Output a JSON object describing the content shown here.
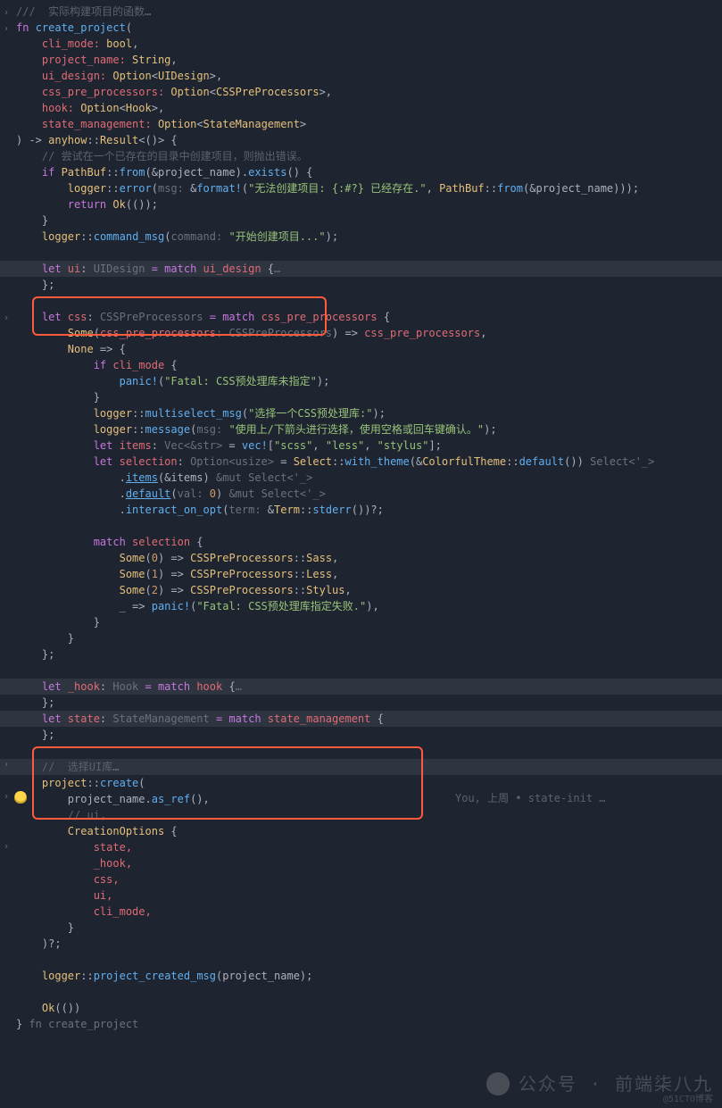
{
  "folds": [
    "›",
    "›",
    "›",
    "›",
    "›",
    "›"
  ],
  "blame": {
    "text": "You, 上周 • state-init …"
  },
  "watermark": {
    "brand": "公众号 · 前端柒八九",
    "small": "@51CTO博客"
  },
  "code": {
    "l1": {
      "a": "///  实际构建项目的函数",
      "b": "…"
    },
    "l2": {
      "a": "fn ",
      "b": "create_project",
      "c": "("
    },
    "l3": {
      "a": "    cli_mode: ",
      "b": "bool",
      "c": ","
    },
    "l4": {
      "a": "    project_name: ",
      "b": "String",
      "c": ","
    },
    "l5": {
      "a": "    ui_design: ",
      "b": "Option",
      "c": "<",
      "d": "UIDesign",
      "e": ">,"
    },
    "l6": {
      "a": "    css_pre_processors: ",
      "b": "Option",
      "c": "<",
      "d": "CSSPreProcessors",
      "e": ">,"
    },
    "l7": {
      "a": "    hook: ",
      "b": "Option",
      "c": "<",
      "d": "Hook",
      "e": ">,"
    },
    "l8": {
      "a": "    state_management: ",
      "b": "Option",
      "c": "<",
      "d": "StateManagement",
      "e": ">"
    },
    "l9": {
      "a": ") -> ",
      "b": "anyhow",
      "c": "::",
      "d": "Result",
      "e": "<()> {"
    },
    "l10": {
      "a": "    // 尝试在一个已存在的目录中创建项目，则抛出错误。"
    },
    "l11": {
      "a": "    if ",
      "b": "PathBuf",
      "c": "::",
      "d": "from",
      "e": "(&project_name).",
      "f": "exists",
      "g": "() {"
    },
    "l12": {
      "a": "        ",
      "b": "logger",
      "c": "::",
      "d": "error",
      "e": "(",
      "f": "msg: ",
      "g": "&",
      "h": "format!",
      "i": "(",
      "j": "\"无法创建项目: {:#?} 已经存在.\"",
      "k": ", ",
      "l": "PathBuf",
      "m": "::",
      "n": "from",
      "o": "(&project_name)));"
    },
    "l13": {
      "a": "        return ",
      "b": "Ok",
      "c": "(());"
    },
    "l14": {
      "a": "    }"
    },
    "l15": {
      "a": "    ",
      "b": "logger",
      "c": "::",
      "d": "command_msg",
      "e": "(",
      "f": "command: ",
      "g": "\"开始创建项目...\"",
      "h": ");"
    },
    "l16": {
      "a": ""
    },
    "l17": {
      "a": "    let ",
      "b": "ui",
      "c": ": ",
      "d": "UIDesign",
      "e": " = match ",
      "f": "ui_design",
      " g": " {",
      "h": "…"
    },
    "l18": {
      "a": "    };"
    },
    "l19": {
      "a": ""
    },
    "l20": {
      "a": "    let ",
      "b": "css",
      "c": ": ",
      "d": "CSSPreProcessors",
      "e": " = match ",
      "f": "css_pre_processors",
      " g": " {"
    },
    "l21": {
      "a": "        ",
      "b": "Some",
      "c": "(",
      "d": "css_pre_processors",
      "e": ": ",
      "f": "CSSPreProcessors",
      "g": ") => ",
      "h": "css_pre_processors",
      "i": ","
    },
    "l22": {
      "a": "        ",
      "b": "None",
      "c": " => {"
    },
    "l23": {
      "a": "            if ",
      "b": "cli_mode",
      " c": " {"
    },
    "l24": {
      "a": "                ",
      "b": "panic!",
      "c": "(",
      "d": "\"Fatal: CSS预处理库未指定\"",
      "e": ");"
    },
    "l25": {
      "a": "            }"
    },
    "l26": {
      "a": "            ",
      "b": "logger",
      "c": "::",
      "d": "multiselect_msg",
      "e": "(",
      "f": "\"选择一个CSS预处理库:\"",
      "g": ");"
    },
    "l27": {
      "a": "            ",
      "b": "logger",
      "c": "::",
      "d": "message",
      "e": "(",
      "f": "msg: ",
      "g": "\"使用上/下箭头进行选择，使用空格或回车键确认。\"",
      "h": ");"
    },
    "l28": {
      "a": "            let ",
      "b": "items",
      "c": ": ",
      "d": "Vec<&str>",
      "e": " = ",
      "f": "vec!",
      "g": "[",
      "h": "\"scss\"",
      "i": ", ",
      "j": "\"less\"",
      "k": ", ",
      "l": "\"stylus\"",
      "m": "];"
    },
    "l29": {
      "a": "            let ",
      "b": "selection",
      "c": ": ",
      "d": "Option<usize>",
      "e": " = ",
      "f": "Select",
      "g": "::",
      "h": "with_theme",
      "i": "(&",
      "j": "ColorfulTheme",
      "k": "::",
      "l": "default",
      "m": "()) ",
      "n": "Select<'_>"
    },
    "l30": {
      "a": "                .",
      "b": "items",
      "c": "(&items) ",
      "d": "&mut Select<'_>"
    },
    "l31": {
      "a": "                .",
      "b": "default",
      "c": "(",
      "d": "val: ",
      "e": "0",
      "f": ") ",
      "g": "&mut Select<'_>"
    },
    "l32": {
      "a": "                .",
      "b": "interact_on_opt",
      "c": "(",
      "d": "term: ",
      "e": "&",
      "f": "Term",
      "g": "::",
      "h": "stderr",
      "i": "())?;"
    },
    "l33": {
      "a": ""
    },
    "l34": {
      "a": "            match ",
      "b": "selection",
      " c": " {"
    },
    "l35": {
      "a": "                ",
      "b": "Some",
      "c": "(",
      "d": "0",
      "e": ") => ",
      "f": "CSSPreProcessors",
      "g": "::",
      "h": "Sass",
      "i": ","
    },
    "l36": {
      "a": "                ",
      "b": "Some",
      "c": "(",
      "d": "1",
      "e": ") => ",
      "f": "CSSPreProcessors",
      "g": "::",
      "h": "Less",
      "i": ","
    },
    "l37": {
      "a": "                ",
      "b": "Some",
      "c": "(",
      "d": "2",
      "e": ") => ",
      "f": "CSSPreProcessors",
      "g": "::",
      "h": "Stylus",
      "i": ","
    },
    "l38": {
      "a": "                _ => ",
      "b": "panic!",
      "c": "(",
      "d": "\"Fatal: CSS预处理库指定失败.\"",
      "e": "),"
    },
    "l39": {
      "a": "            }"
    },
    "l40": {
      "a": "        }"
    },
    "l41": {
      "a": "    };"
    },
    "l42": {
      "a": ""
    },
    "l43": {
      "a": "    let ",
      "b": "_hook",
      "c": ": ",
      "d": "Hook",
      "e": " = match ",
      "f": "hook",
      " g": " {",
      "h": "…"
    },
    "l44": {
      "a": "    };"
    },
    "l45": {
      "a": "    let ",
      "b": "state",
      "c": ": ",
      "d": "StateManagement",
      "e": " = match ",
      "f": "state_management",
      " g": " {"
    },
    "l46": {
      "a": "    };"
    },
    "l47": {
      "a": ""
    },
    "l48": {
      "a": "    //  选择UI库",
      "b": "…"
    },
    "l49": {
      "a": "    ",
      "b": "project",
      "c": "::",
      "d": "create",
      "e": "("
    },
    "l50": {
      "a": "        project_name.",
      "b": "as_ref",
      "c": "(),"
    },
    "l51": {
      "a": "        // ui,"
    },
    "l52": {
      "a": "        ",
      "b": "CreationOptions",
      " c": " {"
    },
    "l53": {
      "a": "            state,"
    },
    "l54": {
      "a": "            _hook,"
    },
    "l55": {
      "a": "            css,"
    },
    "l56": {
      "a": "            ui,"
    },
    "l57": {
      "a": "            cli_mode,"
    },
    "l58": {
      "a": "        }"
    },
    "l59": {
      "a": "    )?;"
    },
    "l60": {
      "a": ""
    },
    "l61": {
      "a": "    ",
      "b": "logger",
      "c": "::",
      "d": "project_created_msg",
      "e": "(project_name);"
    },
    "l62": {
      "a": ""
    },
    "l63": {
      "a": "    ",
      "b": "Ok",
      "c": "(())"
    },
    "l64": {
      "a": "} ",
      "b": "fn create_project"
    }
  }
}
